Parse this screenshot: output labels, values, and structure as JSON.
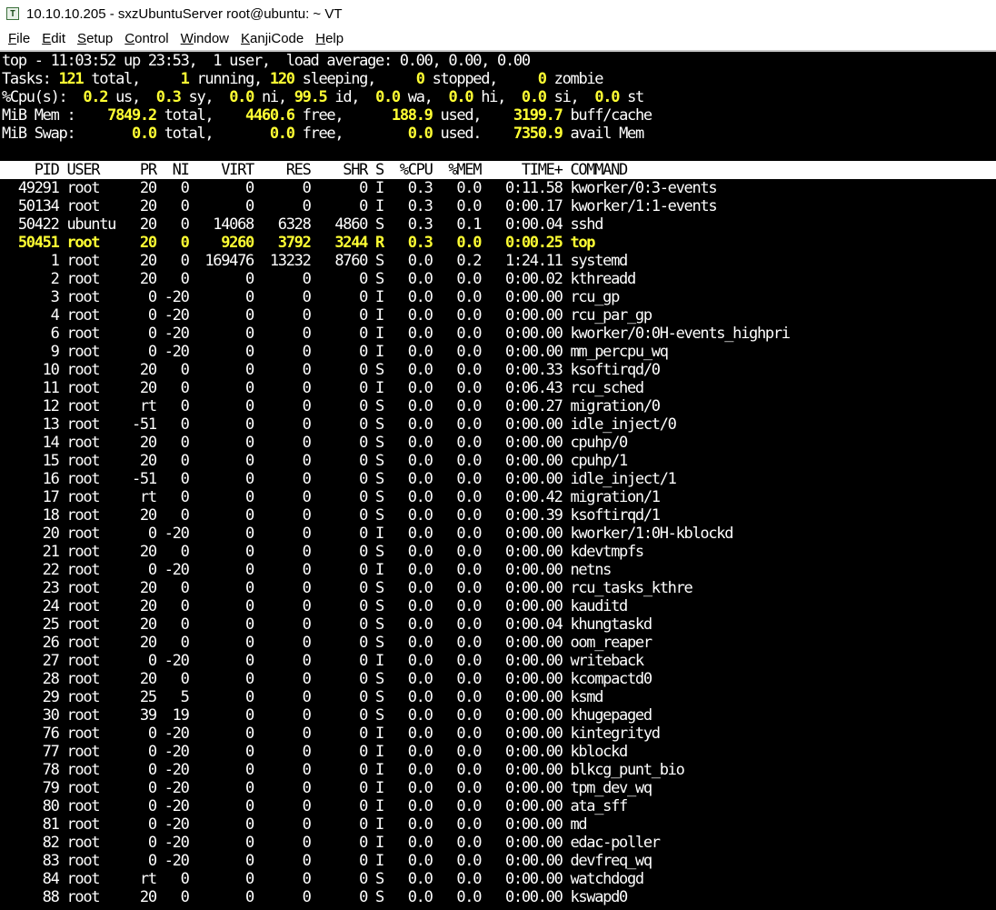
{
  "window": {
    "title": "10.10.10.205 - sxzUbuntuServer root@ubuntu: ~ VT",
    "icon": "terminal-app-icon"
  },
  "menu": [
    {
      "label": "File",
      "accel": "F",
      "rest": "ile"
    },
    {
      "label": "Edit",
      "accel": "E",
      "rest": "dit"
    },
    {
      "label": "Setup",
      "accel": "S",
      "rest": "etup"
    },
    {
      "label": "Control",
      "accel": "C",
      "rest": "ontrol"
    },
    {
      "label": "Window",
      "accel": "W",
      "rest": "indow"
    },
    {
      "label": "KanjiCode",
      "accel": "K",
      "rest": "anjiCode"
    },
    {
      "label": "Help",
      "accel": "H",
      "rest": "elp"
    }
  ],
  "summary": {
    "line1": "top - 11:03:52 up 23:53,  1 user,  load average: 0.00, 0.00, 0.00",
    "tasks": {
      "total": "121",
      "running": "1",
      "sleeping": "120",
      "stopped": "0",
      "zombie": "0"
    },
    "cpu": {
      "us": "0.2",
      "sy": "0.3",
      "ni": "0.0",
      "id": "99.5",
      "wa": "0.0",
      "hi": "0.0",
      "si": "0.0",
      "st": "0.0"
    },
    "mem": {
      "total": "7849.2",
      "free": "4460.6",
      "used": "188.9",
      "buff_cache": "3199.7"
    },
    "swap": {
      "total": "0.0",
      "free": "0.0",
      "used": "0.0",
      "avail_mem": "7350.9"
    }
  },
  "columns": [
    "PID",
    "USER",
    "PR",
    "NI",
    "VIRT",
    "RES",
    "SHR",
    "S",
    "%CPU",
    "%MEM",
    "TIME+",
    "COMMAND"
  ],
  "processes": [
    [
      "49291",
      "root",
      "20",
      "0",
      "0",
      "0",
      "0",
      "I",
      "0.3",
      "0.0",
      "0:11.58",
      "kworker/0:3-events"
    ],
    [
      "50134",
      "root",
      "20",
      "0",
      "0",
      "0",
      "0",
      "I",
      "0.3",
      "0.0",
      "0:00.17",
      "kworker/1:1-events"
    ],
    [
      "50422",
      "ubuntu",
      "20",
      "0",
      "14068",
      "6328",
      "4860",
      "S",
      "0.3",
      "0.1",
      "0:00.04",
      "sshd"
    ],
    [
      "50451",
      "root",
      "20",
      "0",
      "9260",
      "3792",
      "3244",
      "R",
      "0.3",
      "0.0",
      "0:00.25",
      "top"
    ],
    [
      "1",
      "root",
      "20",
      "0",
      "169476",
      "13232",
      "8760",
      "S",
      "0.0",
      "0.2",
      "1:24.11",
      "systemd"
    ],
    [
      "2",
      "root",
      "20",
      "0",
      "0",
      "0",
      "0",
      "S",
      "0.0",
      "0.0",
      "0:00.02",
      "kthreadd"
    ],
    [
      "3",
      "root",
      "0",
      "-20",
      "0",
      "0",
      "0",
      "I",
      "0.0",
      "0.0",
      "0:00.00",
      "rcu_gp"
    ],
    [
      "4",
      "root",
      "0",
      "-20",
      "0",
      "0",
      "0",
      "I",
      "0.0",
      "0.0",
      "0:00.00",
      "rcu_par_gp"
    ],
    [
      "6",
      "root",
      "0",
      "-20",
      "0",
      "0",
      "0",
      "I",
      "0.0",
      "0.0",
      "0:00.00",
      "kworker/0:0H-events_highpri"
    ],
    [
      "9",
      "root",
      "0",
      "-20",
      "0",
      "0",
      "0",
      "I",
      "0.0",
      "0.0",
      "0:00.00",
      "mm_percpu_wq"
    ],
    [
      "10",
      "root",
      "20",
      "0",
      "0",
      "0",
      "0",
      "S",
      "0.0",
      "0.0",
      "0:00.33",
      "ksoftirqd/0"
    ],
    [
      "11",
      "root",
      "20",
      "0",
      "0",
      "0",
      "0",
      "I",
      "0.0",
      "0.0",
      "0:06.43",
      "rcu_sched"
    ],
    [
      "12",
      "root",
      "rt",
      "0",
      "0",
      "0",
      "0",
      "S",
      "0.0",
      "0.0",
      "0:00.27",
      "migration/0"
    ],
    [
      "13",
      "root",
      "-51",
      "0",
      "0",
      "0",
      "0",
      "S",
      "0.0",
      "0.0",
      "0:00.00",
      "idle_inject/0"
    ],
    [
      "14",
      "root",
      "20",
      "0",
      "0",
      "0",
      "0",
      "S",
      "0.0",
      "0.0",
      "0:00.00",
      "cpuhp/0"
    ],
    [
      "15",
      "root",
      "20",
      "0",
      "0",
      "0",
      "0",
      "S",
      "0.0",
      "0.0",
      "0:00.00",
      "cpuhp/1"
    ],
    [
      "16",
      "root",
      "-51",
      "0",
      "0",
      "0",
      "0",
      "S",
      "0.0",
      "0.0",
      "0:00.00",
      "idle_inject/1"
    ],
    [
      "17",
      "root",
      "rt",
      "0",
      "0",
      "0",
      "0",
      "S",
      "0.0",
      "0.0",
      "0:00.42",
      "migration/1"
    ],
    [
      "18",
      "root",
      "20",
      "0",
      "0",
      "0",
      "0",
      "S",
      "0.0",
      "0.0",
      "0:00.39",
      "ksoftirqd/1"
    ],
    [
      "20",
      "root",
      "0",
      "-20",
      "0",
      "0",
      "0",
      "I",
      "0.0",
      "0.0",
      "0:00.00",
      "kworker/1:0H-kblockd"
    ],
    [
      "21",
      "root",
      "20",
      "0",
      "0",
      "0",
      "0",
      "S",
      "0.0",
      "0.0",
      "0:00.00",
      "kdevtmpfs"
    ],
    [
      "22",
      "root",
      "0",
      "-20",
      "0",
      "0",
      "0",
      "I",
      "0.0",
      "0.0",
      "0:00.00",
      "netns"
    ],
    [
      "23",
      "root",
      "20",
      "0",
      "0",
      "0",
      "0",
      "S",
      "0.0",
      "0.0",
      "0:00.00",
      "rcu_tasks_kthre"
    ],
    [
      "24",
      "root",
      "20",
      "0",
      "0",
      "0",
      "0",
      "S",
      "0.0",
      "0.0",
      "0:00.00",
      "kauditd"
    ],
    [
      "25",
      "root",
      "20",
      "0",
      "0",
      "0",
      "0",
      "S",
      "0.0",
      "0.0",
      "0:00.04",
      "khungtaskd"
    ],
    [
      "26",
      "root",
      "20",
      "0",
      "0",
      "0",
      "0",
      "S",
      "0.0",
      "0.0",
      "0:00.00",
      "oom_reaper"
    ],
    [
      "27",
      "root",
      "0",
      "-20",
      "0",
      "0",
      "0",
      "I",
      "0.0",
      "0.0",
      "0:00.00",
      "writeback"
    ],
    [
      "28",
      "root",
      "20",
      "0",
      "0",
      "0",
      "0",
      "S",
      "0.0",
      "0.0",
      "0:00.00",
      "kcompactd0"
    ],
    [
      "29",
      "root",
      "25",
      "5",
      "0",
      "0",
      "0",
      "S",
      "0.0",
      "0.0",
      "0:00.00",
      "ksmd"
    ],
    [
      "30",
      "root",
      "39",
      "19",
      "0",
      "0",
      "0",
      "S",
      "0.0",
      "0.0",
      "0:00.00",
      "khugepaged"
    ],
    [
      "76",
      "root",
      "0",
      "-20",
      "0",
      "0",
      "0",
      "I",
      "0.0",
      "0.0",
      "0:00.00",
      "kintegrityd"
    ],
    [
      "77",
      "root",
      "0",
      "-20",
      "0",
      "0",
      "0",
      "I",
      "0.0",
      "0.0",
      "0:00.00",
      "kblockd"
    ],
    [
      "78",
      "root",
      "0",
      "-20",
      "0",
      "0",
      "0",
      "I",
      "0.0",
      "0.0",
      "0:00.00",
      "blkcg_punt_bio"
    ],
    [
      "79",
      "root",
      "0",
      "-20",
      "0",
      "0",
      "0",
      "I",
      "0.0",
      "0.0",
      "0:00.00",
      "tpm_dev_wq"
    ],
    [
      "80",
      "root",
      "0",
      "-20",
      "0",
      "0",
      "0",
      "I",
      "0.0",
      "0.0",
      "0:00.00",
      "ata_sff"
    ],
    [
      "81",
      "root",
      "0",
      "-20",
      "0",
      "0",
      "0",
      "I",
      "0.0",
      "0.0",
      "0:00.00",
      "md"
    ],
    [
      "82",
      "root",
      "0",
      "-20",
      "0",
      "0",
      "0",
      "I",
      "0.0",
      "0.0",
      "0:00.00",
      "edac-poller"
    ],
    [
      "83",
      "root",
      "0",
      "-20",
      "0",
      "0",
      "0",
      "I",
      "0.0",
      "0.0",
      "0:00.00",
      "devfreq_wq"
    ],
    [
      "84",
      "root",
      "rt",
      "0",
      "0",
      "0",
      "0",
      "S",
      "0.0",
      "0.0",
      "0:00.00",
      "watchdogd"
    ],
    [
      "88",
      "root",
      "20",
      "0",
      "0",
      "0",
      "0",
      "S",
      "0.0",
      "0.0",
      "0:00.00",
      "kswapd0"
    ]
  ],
  "highlight_pid": "50451",
  "colors": {
    "terminal_bg": "#000000",
    "text": "#ffffff",
    "highlight": "#ffff33",
    "header_bg": "#ffffff"
  }
}
